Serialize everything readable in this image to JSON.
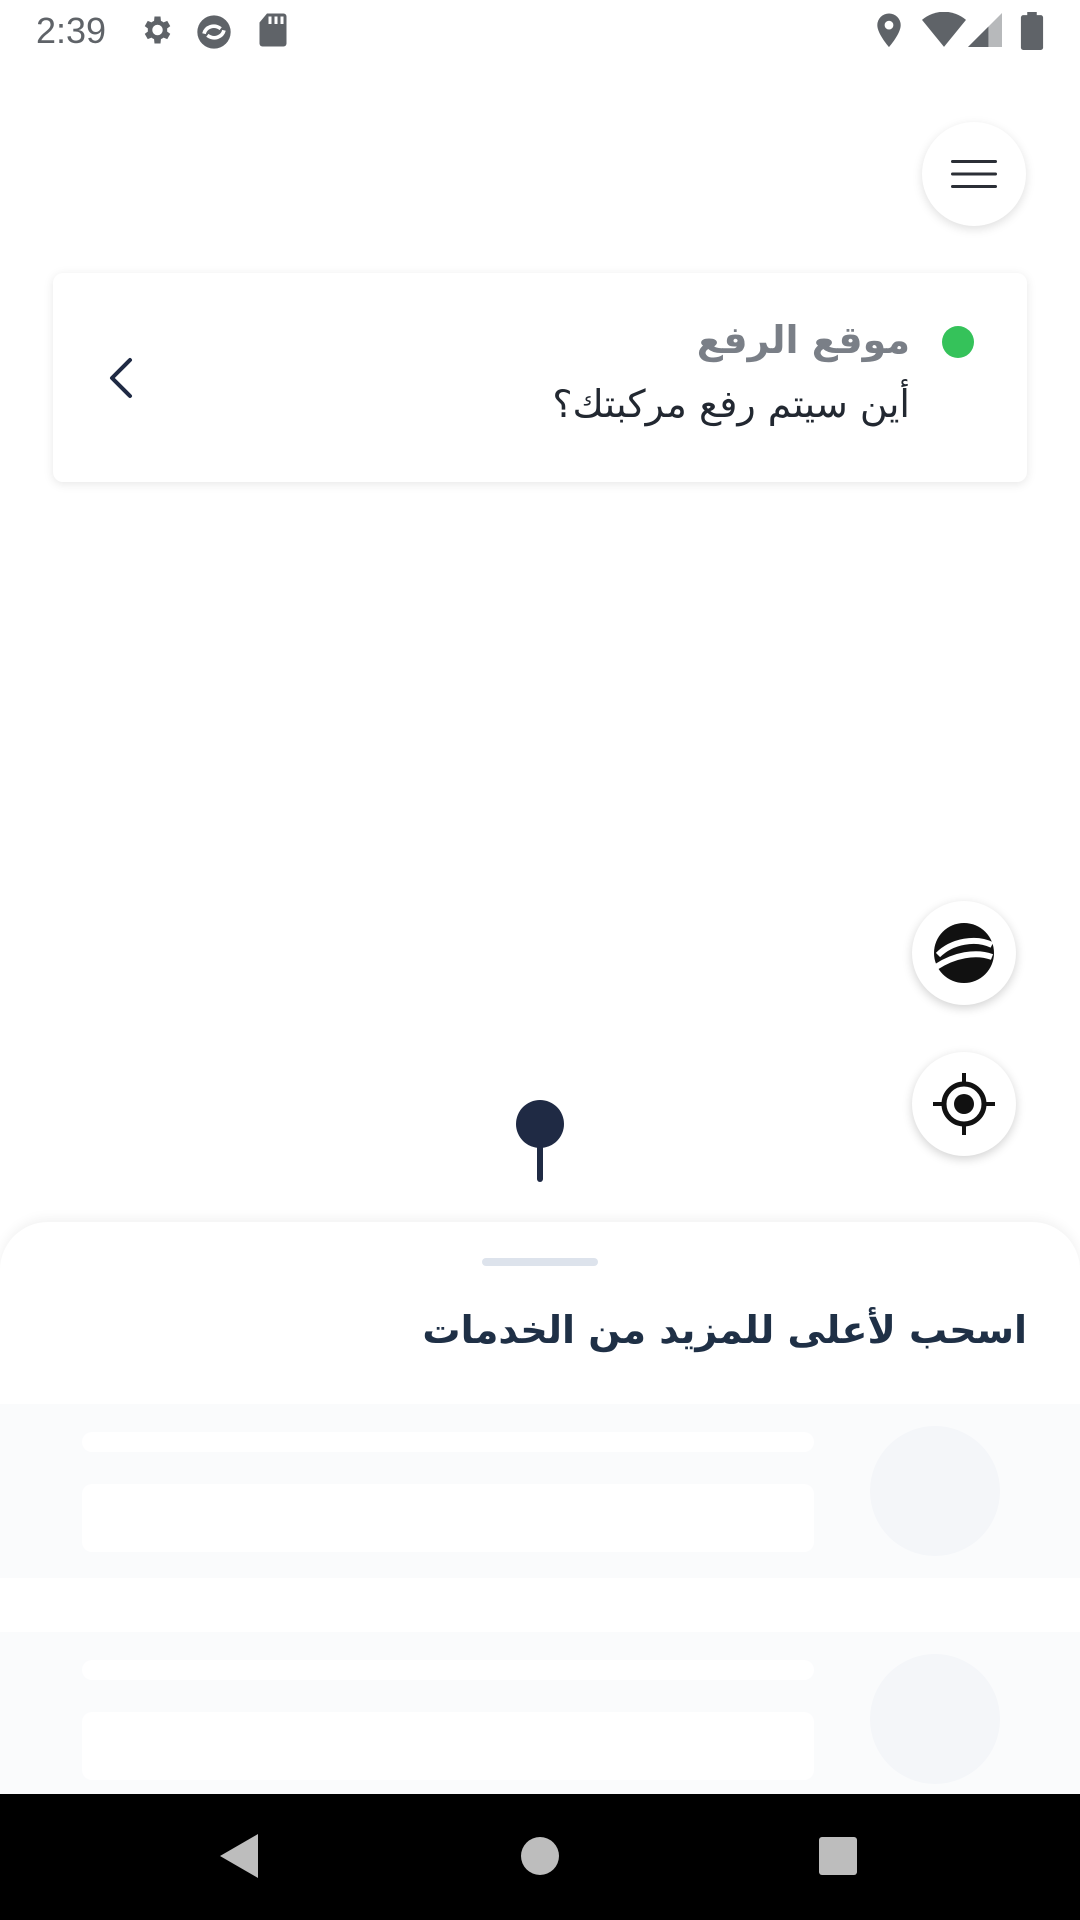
{
  "status_bar": {
    "time": "2:39",
    "icons_left": [
      "settings-icon",
      "sync-app-icon",
      "sd-card-icon"
    ],
    "icons_right": [
      "location-icon",
      "wifi-icon",
      "signal-icon",
      "battery-icon"
    ]
  },
  "header": {
    "menu_icon": "hamburger-menu-icon"
  },
  "pickup_card": {
    "title": "موقع الرفع",
    "subtitle": "أين سيتم رفع مركبتك؟",
    "indicator_color": "#35c25a",
    "chevron_icon": "chevron-left-icon"
  },
  "map_controls": {
    "map_type_icon": "map-layers-icon",
    "locate_icon": "my-location-icon"
  },
  "bottom_sheet": {
    "title": "اسحب لأعلى للمزيد من الخدمات"
  },
  "nav_bar": {
    "back_icon": "back-triangle-icon",
    "home_icon": "home-circle-icon",
    "recents_icon": "recents-square-icon"
  },
  "colors": {
    "accent_dark": "#1f2a44",
    "indicator_green": "#35c25a",
    "title_text": "#1f3046"
  }
}
